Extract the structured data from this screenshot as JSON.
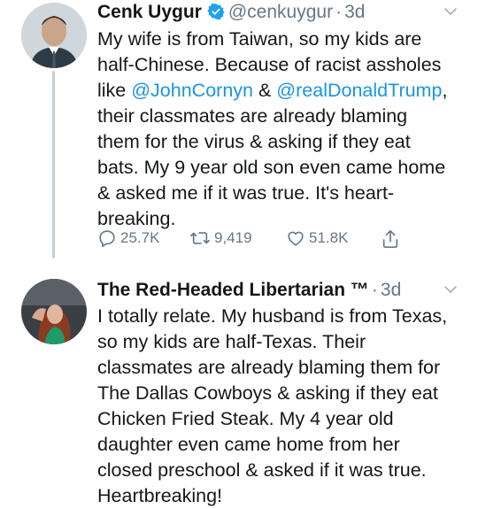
{
  "tweets": [
    {
      "name": "Cenk Uygur",
      "handle": "@cenkuygur",
      "sep": "·",
      "time": "3d",
      "verified": true,
      "text_lines": [
        "My wife is from Taiwan, so my kids are",
        "half-Chinese. Because of racist assholes",
        {
          "pre": "like ",
          "m1": "@JohnCornyn",
          "mid": " & ",
          "m2": "@realDonaldTrump",
          "post": ","
        },
        "their classmates are already blaming",
        "them for the virus & asking if they eat",
        "bats. My 9 year old son even came home",
        "& asked me if it was true. It's heart-",
        "breaking."
      ],
      "actions": {
        "replies": "25.7K",
        "retweets": "9,419",
        "likes": "51.8K"
      }
    },
    {
      "name": "The Red-Headed Libertarian ™",
      "sep": "·",
      "time": "3d",
      "text_lines": [
        "I totally relate. My husband is from Texas,",
        "so my kids are half-Texas. Their",
        "classmates are already blaming them for",
        "The Dallas Cowboys & asking if they eat",
        "Chicken Fried Steak. My 4 year old",
        "daughter even came home from her",
        "closed preschool & asked if it was true.",
        "Heartbreaking!"
      ]
    }
  ],
  "icons": {
    "verified": "verified-badge-icon",
    "caret": "chevron-down-icon",
    "reply": "reply-icon",
    "retweet": "retweet-icon",
    "like": "like-icon",
    "share": "share-icon"
  },
  "colors": {
    "accent": "#1da1f2",
    "mention": "#1b95e0",
    "muted": "#657786",
    "text": "#14171a"
  }
}
